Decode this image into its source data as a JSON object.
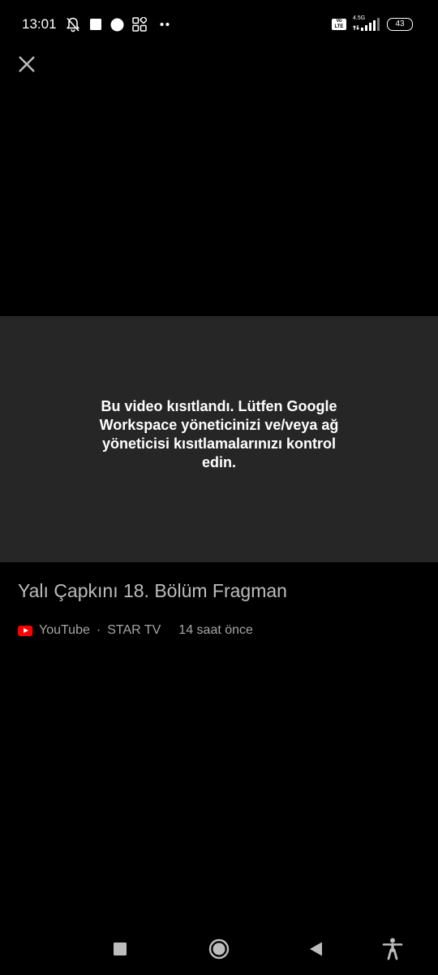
{
  "status_bar": {
    "time": "13:01",
    "network_label": "4.5G",
    "volte_label": "Vo\nLTE",
    "battery": "43",
    "icons": [
      "bell-off-icon",
      "square-notification-icon",
      "circle-notification-icon",
      "grid-notification-icon",
      "more-dots-icon",
      "volte-icon",
      "signal-icon",
      "battery-icon"
    ]
  },
  "header": {
    "close_icon": "close-icon"
  },
  "player": {
    "restricted_message": "Bu video kısıtlandı. Lütfen Google Workspace yöneticinizi ve/veya ağ yöneticisi kısıtlamalarınızı kontrol edin.",
    "panel_color": "#262626"
  },
  "video": {
    "title": "Yalı Çapkını 18. Bölüm Fragman",
    "source": "YouTube",
    "separator": "·",
    "channel": "STAR TV",
    "time_ago": "14 saat önce",
    "brand_color": "#ff0000"
  },
  "nav": {
    "icons": [
      "recents-square-icon",
      "home-circle-icon",
      "back-triangle-icon",
      "accessibility-icon"
    ]
  }
}
